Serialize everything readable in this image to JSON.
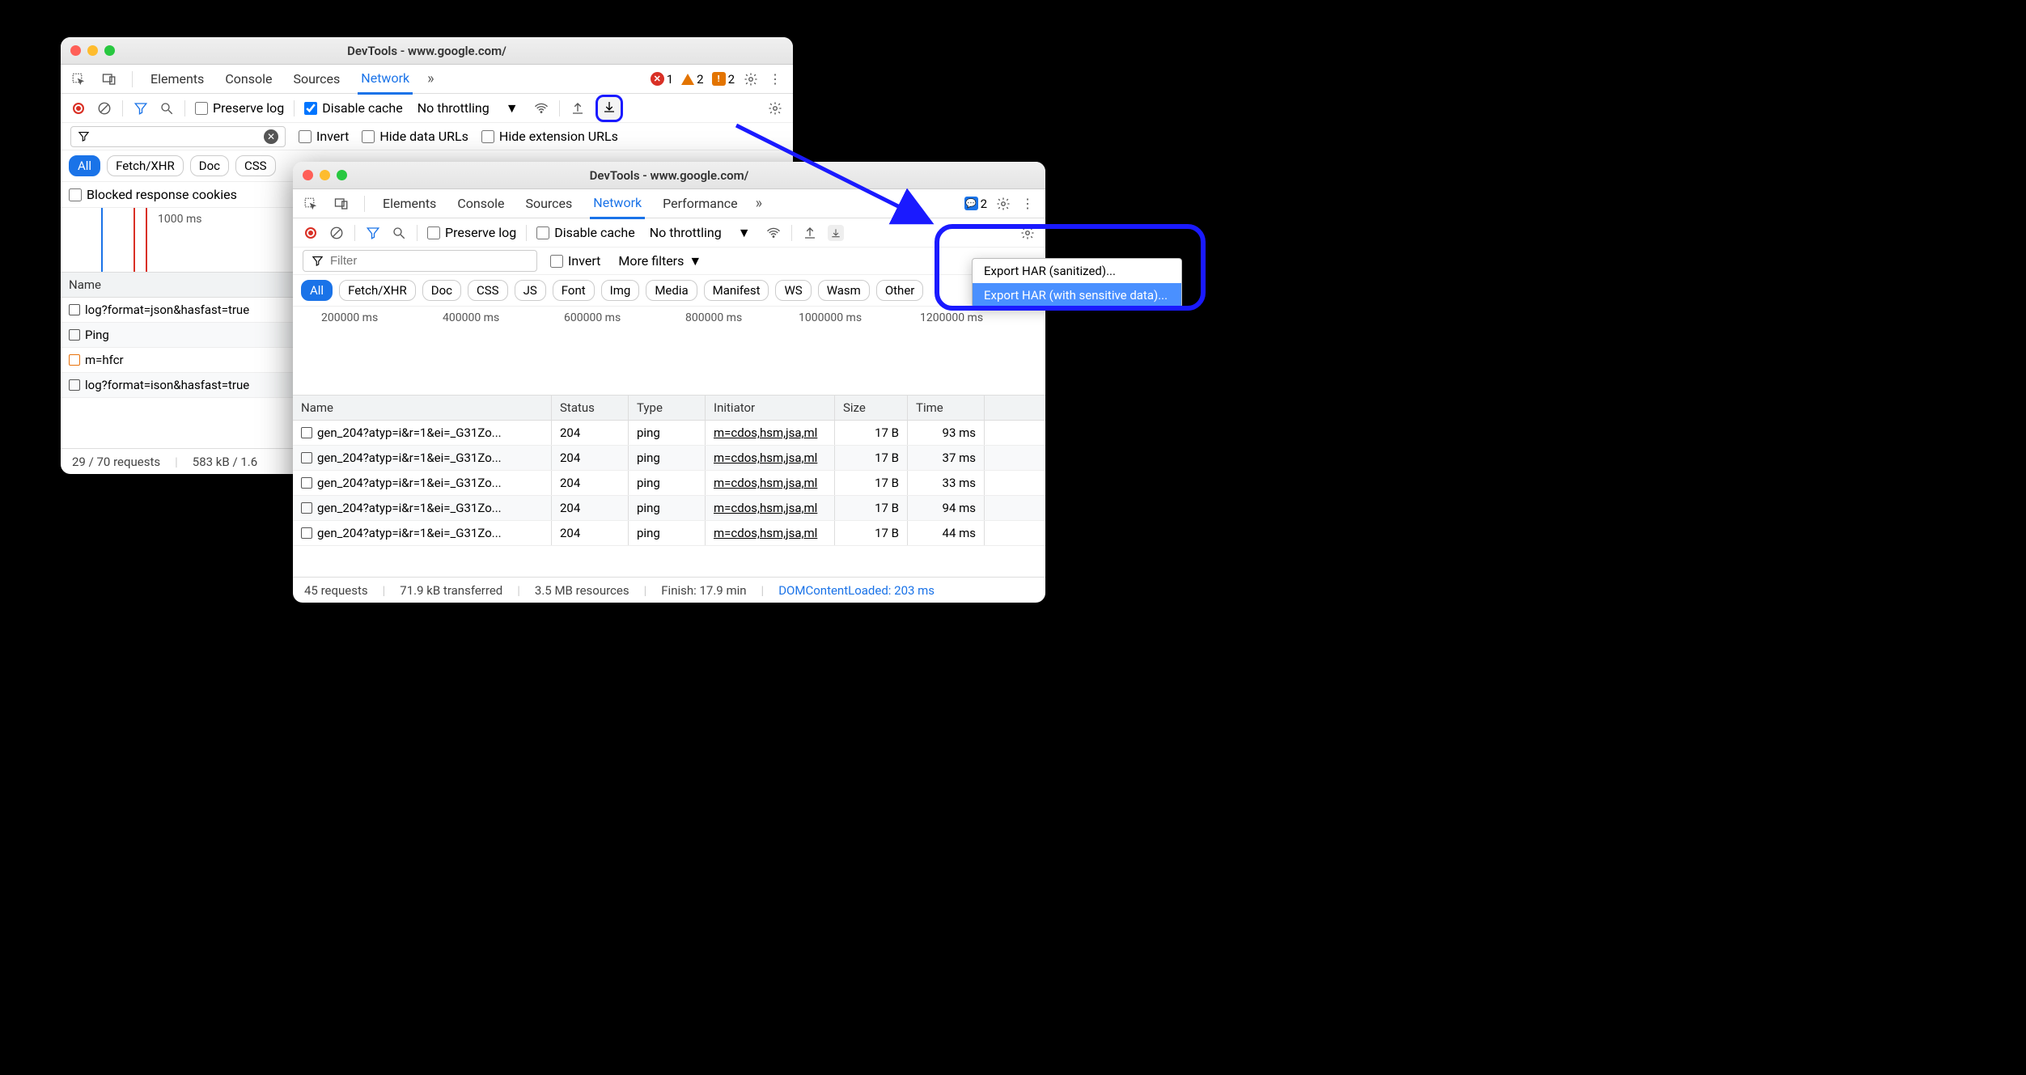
{
  "window1": {
    "title": "DevTools - www.google.com/",
    "tabs": {
      "elements": "Elements",
      "console": "Console",
      "sources": "Sources",
      "network": "Network"
    },
    "badges": {
      "errors": "1",
      "warnings": "2",
      "issues": "2"
    },
    "toolbar": {
      "preserve_log": "Preserve log",
      "disable_cache": "Disable cache",
      "throttling": "No throttling"
    },
    "filterbar": {
      "invert": "Invert",
      "hide_data": "Hide data URLs",
      "hide_ext": "Hide extension URLs"
    },
    "chips": {
      "all": "All",
      "fetch": "Fetch/XHR",
      "doc": "Doc",
      "css": "CSS"
    },
    "blocked_cookies": "Blocked response cookies",
    "overview": {
      "label": "1000 ms"
    },
    "table_header": {
      "name": "Name"
    },
    "rows": [
      {
        "name": "log?format=json&hasfast=true"
      },
      {
        "name": "Ping"
      },
      {
        "name": "m=hfcr"
      },
      {
        "name": "log?format=ison&hasfast=true"
      }
    ],
    "status": {
      "requests": "29 / 70 requests",
      "transferred": "583 kB / 1.6"
    }
  },
  "window2": {
    "title": "DevTools - www.google.com/",
    "tabs": {
      "elements": "Elements",
      "console": "Console",
      "sources": "Sources",
      "network": "Network",
      "performance": "Performance"
    },
    "badges": {
      "issues": "2"
    },
    "toolbar": {
      "preserve_log": "Preserve log",
      "disable_cache": "Disable cache",
      "throttling": "No throttling"
    },
    "filterbar": {
      "filter_placeholder": "Filter",
      "invert": "Invert",
      "more_filters": "More filters"
    },
    "chips": {
      "all": "All",
      "fetch": "Fetch/XHR",
      "doc": "Doc",
      "css": "CSS",
      "js": "JS",
      "font": "Font",
      "img": "Img",
      "media": "Media",
      "manifest": "Manifest",
      "ws": "WS",
      "wasm": "Wasm",
      "other": "Other"
    },
    "overview_labels": [
      "200000 ms",
      "400000 ms",
      "600000 ms",
      "800000 ms",
      "1000000 ms",
      "1200000 ms"
    ],
    "table_header": {
      "name": "Name",
      "status": "Status",
      "type": "Type",
      "initiator": "Initiator",
      "size": "Size",
      "time": "Time"
    },
    "rows": [
      {
        "name": "gen_204?atyp=i&r=1&ei=_G31Zo...",
        "status": "204",
        "type": "ping",
        "initiator": "m=cdos,hsm,jsa,ml",
        "size": "17 B",
        "time": "93 ms"
      },
      {
        "name": "gen_204?atyp=i&r=1&ei=_G31Zo...",
        "status": "204",
        "type": "ping",
        "initiator": "m=cdos,hsm,jsa,ml",
        "size": "17 B",
        "time": "37 ms"
      },
      {
        "name": "gen_204?atyp=i&r=1&ei=_G31Zo...",
        "status": "204",
        "type": "ping",
        "initiator": "m=cdos,hsm,jsa,ml",
        "size": "17 B",
        "time": "33 ms"
      },
      {
        "name": "gen_204?atyp=i&r=1&ei=_G31Zo...",
        "status": "204",
        "type": "ping",
        "initiator": "m=cdos,hsm,jsa,ml",
        "size": "17 B",
        "time": "94 ms"
      },
      {
        "name": "gen_204?atyp=i&r=1&ei=_G31Zo...",
        "status": "204",
        "type": "ping",
        "initiator": "m=cdos,hsm,jsa,ml",
        "size": "17 B",
        "time": "44 ms"
      }
    ],
    "status": {
      "requests": "45 requests",
      "transferred": "71.9 kB transferred",
      "resources": "3.5 MB resources",
      "finish": "Finish: 17.9 min",
      "dcl": "DOMContentLoaded: 203 ms"
    }
  },
  "dropdown": {
    "item1": "Export HAR (sanitized)...",
    "item2": "Export HAR (with sensitive data)..."
  }
}
